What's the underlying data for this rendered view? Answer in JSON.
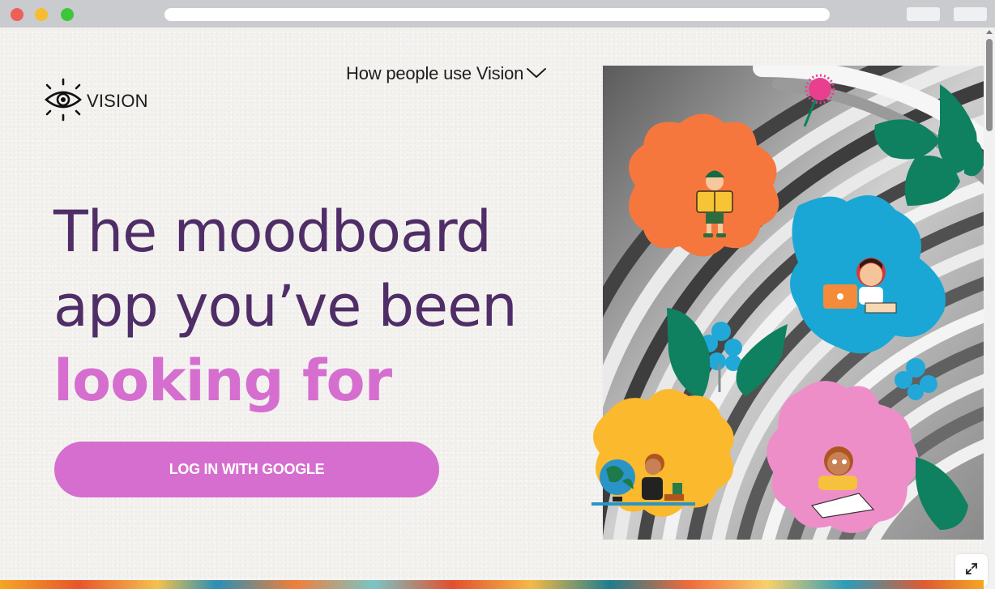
{
  "brand": {
    "name": "VISION"
  },
  "nav": {
    "menu_label": "How people use Vision"
  },
  "hero": {
    "line1": "The moodboard",
    "line2": "app you’ve been",
    "accent": "looking for"
  },
  "cta": {
    "login_label": "LOG IN WITH GOOGLE"
  },
  "colors": {
    "headline": "#4f2d67",
    "accent": "#d56ecf",
    "flower_orange": "#f6773d",
    "flower_blue": "#1aa7d6",
    "flower_yellow": "#fbb92e",
    "flower_pink": "#ee8ec9",
    "leaf_green": "#0f8060",
    "petal_cyan": "#22a8d8",
    "dandelion_pink": "#e93f8e"
  },
  "icons": {
    "logo": "eye-icon",
    "menu": "chevron-down-icon",
    "fullscreen": "expand-icon"
  }
}
